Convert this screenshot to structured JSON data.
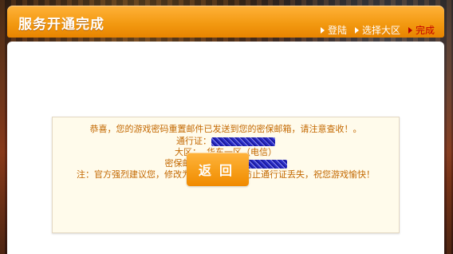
{
  "page": {
    "title": "服务开通完成",
    "steps": [
      {
        "label": "登陆",
        "active": false
      },
      {
        "label": "选择大区",
        "active": false
      },
      {
        "label": "完成",
        "active": true
      }
    ]
  },
  "message": {
    "line1": "恭喜，您的游戏密码重置邮件已发送到您的密保邮箱，请注意查收！。",
    "account_label": "通行证：",
    "server_label": "大区：",
    "server_value": "华东一区（电信）",
    "email_label": "密保邮箱：",
    "note": "注：官方强烈建议您，修改为复杂的密码，防止通行证丢失，祝您游戏愉快！"
  },
  "actions": {
    "return_label": "返回"
  },
  "colors": {
    "accent": "#f39a12",
    "text": "#c36800",
    "active_step": "#c40000"
  }
}
